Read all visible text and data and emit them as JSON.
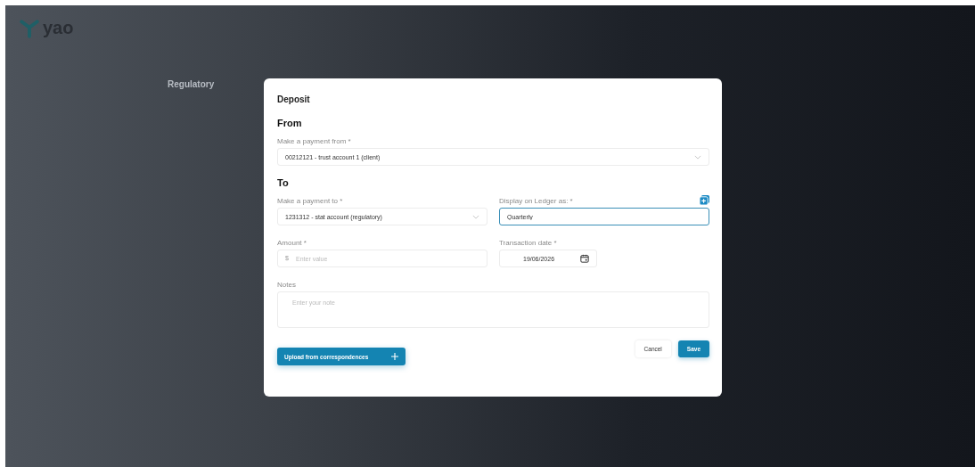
{
  "app": {
    "logo": "yao"
  },
  "page": {
    "title": "Regulatory"
  },
  "dialog": {
    "title": "Deposit",
    "sections": [
      {
        "heading": "From",
        "rows": [
          [
            {
              "kind": "select",
              "label": "Make a payment from *",
              "value": "00212121 - trust account 1 (client)",
              "focused": false
            }
          ]
        ]
      },
      {
        "heading": "To",
        "rows": [
          [
            {
              "kind": "select",
              "label": "Make a payment to *",
              "value": "1231312 - stat account (regulatory)",
              "focused": false
            },
            {
              "kind": "text",
              "label": "Display on Ledger as: *",
              "value": "Quarterly",
              "focused": true,
              "add_button": true
            }
          ],
          [
            {
              "kind": "currency",
              "label": "Amount *",
              "prefix": "$",
              "placeholder": "Enter value",
              "focused": false
            },
            {
              "kind": "date",
              "label": "Transaction date *",
              "value": "19/06/2026",
              "focused": false
            }
          ],
          [
            {
              "kind": "textarea",
              "label": "Notes",
              "placeholder": "Enter your note",
              "focused": false
            }
          ]
        ]
      }
    ],
    "upload_button": "Upload from correspondences",
    "buttons": [
      {
        "label": "Cancel",
        "kind": "secondary"
      },
      {
        "label": "Save",
        "kind": "primary"
      }
    ]
  }
}
